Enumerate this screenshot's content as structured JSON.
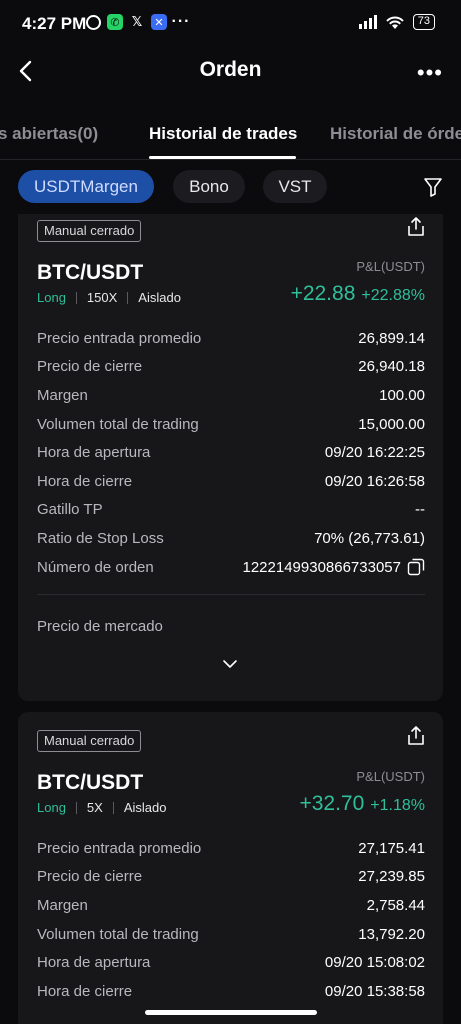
{
  "status_bar": {
    "time": "4:27 PM",
    "icons": [
      "alarm-icon",
      "whatsapp-icon",
      "x-icon",
      "app-icon",
      "more-icon"
    ],
    "battery": "73"
  },
  "header": {
    "title": "Orden",
    "back_icon": "chevron-left-icon",
    "menu_icon": "more-icon"
  },
  "tabs": [
    {
      "label": "s abiertas(0)",
      "active": false
    },
    {
      "label": "Historial de trades",
      "active": true
    },
    {
      "label": "Historial de órde",
      "active": false
    }
  ],
  "filters": {
    "chips": [
      {
        "label": "USDTMargen",
        "active": true
      },
      {
        "label": "Bono",
        "active": false
      },
      {
        "label": "VST",
        "active": false
      }
    ],
    "icon": "filter-icon"
  },
  "colors": {
    "background": "#0b0b0d",
    "card": "#17171a",
    "profit": "#2fbf9b",
    "active_chip": "#1e4fa7"
  },
  "cards": [
    {
      "tag": "Manual cerrado",
      "pair": "BTC/USDT",
      "side": "Long",
      "leverage": "150X",
      "margin_mode": "Aislado",
      "pnl_label": "P&L(USDT)",
      "pnl_amount": "+22.88",
      "pnl_pct": "+22.88%",
      "rows": [
        {
          "label": "Precio entrada promedio",
          "value": "26,899.14"
        },
        {
          "label": "Precio de cierre",
          "value": "26,940.18"
        },
        {
          "label": "Margen",
          "value": "100.00"
        },
        {
          "label": "Volumen total de trading",
          "value": "15,000.00"
        },
        {
          "label": "Hora de apertura",
          "value": "09/20 16:22:25"
        },
        {
          "label": "Hora de cierre",
          "value": "09/20 16:26:58"
        },
        {
          "label": "Gatillo TP",
          "value": "--"
        },
        {
          "label": "Ratio de Stop Loss",
          "value": "70% (26,773.61)"
        },
        {
          "label": "Número de orden",
          "value": "1222149930866733057"
        }
      ],
      "market_label": "Precio de mercado"
    },
    {
      "tag": "Manual cerrado",
      "pair": "BTC/USDT",
      "side": "Long",
      "leverage": "5X",
      "margin_mode": "Aislado",
      "pnl_label": "P&L(USDT)",
      "pnl_amount": "+32.70",
      "pnl_pct": "+1.18%",
      "rows": [
        {
          "label": "Precio entrada promedio",
          "value": "27,175.41"
        },
        {
          "label": "Precio de cierre",
          "value": "27,239.85"
        },
        {
          "label": "Margen",
          "value": "2,758.44"
        },
        {
          "label": "Volumen total de trading",
          "value": "13,792.20"
        },
        {
          "label": "Hora de apertura",
          "value": "09/20 15:08:02"
        },
        {
          "label": "Hora de cierre",
          "value": "09/20 15:38:58"
        }
      ]
    }
  ]
}
